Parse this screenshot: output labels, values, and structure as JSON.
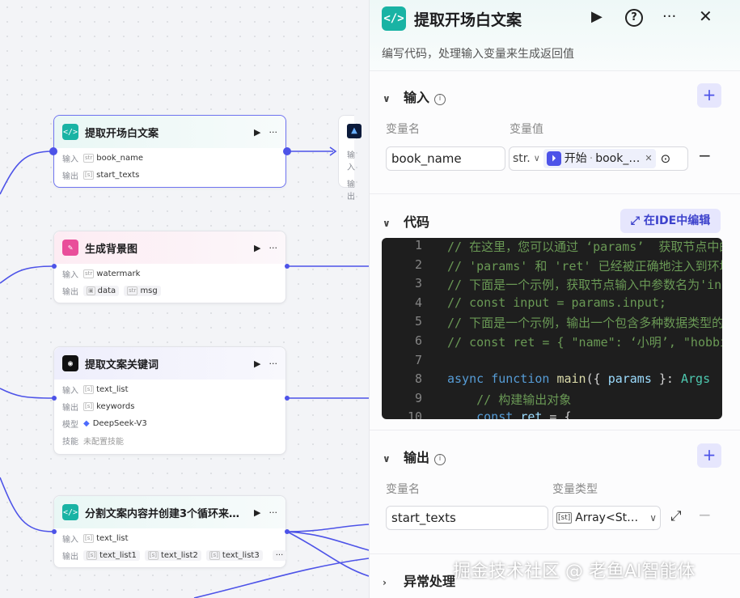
{
  "canvas": {
    "nodes": [
      {
        "title": "提取开场白文案",
        "icon": "code-icon",
        "color": "#19b3a4",
        "rows": [
          {
            "label": "输入",
            "tags": [
              {
                "type": "str",
                "name": "book_name"
              }
            ]
          },
          {
            "label": "输出",
            "tags": [
              {
                "type": "[str]",
                "name": "start_texts"
              }
            ]
          }
        ]
      },
      {
        "title": "生成背景图",
        "icon": "image-gen-icon",
        "color": "#e94e9a",
        "rows": [
          {
            "label": "输入",
            "tags": [
              {
                "type": "str",
                "name": "watermark"
              }
            ]
          },
          {
            "label": "输出",
            "tags": [
              {
                "type": "img",
                "name": "data"
              },
              {
                "type": "str",
                "name": "msg"
              }
            ]
          }
        ]
      },
      {
        "title": "提取文案关键词",
        "icon": "llm-icon",
        "color": "#111111",
        "rows": [
          {
            "label": "输入",
            "tags": [
              {
                "type": "[str]",
                "name": "text_list"
              }
            ]
          },
          {
            "label": "输出",
            "tags": [
              {
                "type": "[str]",
                "name": "keywords"
              }
            ]
          },
          {
            "label": "模型",
            "tags": [
              {
                "type": "model",
                "name": "DeepSeek-V3"
              }
            ]
          },
          {
            "label": "技能",
            "tags": [
              {
                "type": "none",
                "name": "未配置技能"
              }
            ]
          }
        ]
      },
      {
        "title": "分割文案内容并创建3个循环来…",
        "icon": "code-icon",
        "color": "#19b3a4",
        "rows": [
          {
            "label": "输入",
            "tags": [
              {
                "type": "[str]",
                "name": "text_list"
              }
            ]
          },
          {
            "label": "输出",
            "tags": [
              {
                "type": "[str]",
                "name": "text_list1"
              },
              {
                "type": "[str]",
                "name": "text_list2"
              },
              {
                "type": "[str]",
                "name": "text_list3"
              },
              {
                "type": "more",
                "name": "···"
              }
            ]
          }
        ]
      }
    ],
    "stub_labels": [
      "输入",
      "输出"
    ]
  },
  "panel": {
    "title": "提取开场白文案",
    "description": "编写代码，处理输入变量来生成返回值",
    "input": {
      "title": "输入",
      "col_name": "变量名",
      "col_value": "变量值",
      "var_name": "book_name",
      "type_select": "str.",
      "ref_source": "开始",
      "ref_var": "book_…"
    },
    "code": {
      "title": "代码",
      "ide_button": "在IDE中编辑",
      "lines": [
        {
          "n": "1",
          "parts": [
            {
              "c": "cmt",
              "t": "// 在这里，您可以通过 ‘params’  获取节点中的输入变量"
            }
          ]
        },
        {
          "n": "2",
          "parts": [
            {
              "c": "cmt",
              "t": "// 'params' 和 'ret' 已经被正确地注入到环境中"
            }
          ]
        },
        {
          "n": "3",
          "parts": [
            {
              "c": "cmt",
              "t": "// 下面是一个示例，获取节点输入中参数名为'input'的值"
            }
          ]
        },
        {
          "n": "4",
          "parts": [
            {
              "c": "cmt",
              "t": "// const input = params.input;"
            }
          ]
        },
        {
          "n": "5",
          "parts": [
            {
              "c": "cmt",
              "t": "// 下面是一个示例，输出一个包含多种数据类型的 'ret' 对象"
            }
          ]
        },
        {
          "n": "6",
          "parts": [
            {
              "c": "cmt",
              "t": "// const ret = { \"name\": ‘小明’, \"hobbies\""
            }
          ]
        },
        {
          "n": "7",
          "parts": [
            {
              "c": "pl",
              "t": ""
            }
          ]
        },
        {
          "n": "8",
          "parts": [
            {
              "c": "kw",
              "t": "async"
            },
            {
              "c": "pl",
              "t": " "
            },
            {
              "c": "kw",
              "t": "function"
            },
            {
              "c": "pl",
              "t": " "
            },
            {
              "c": "fn",
              "t": "main"
            },
            {
              "c": "pl",
              "t": "({ "
            },
            {
              "c": "var",
              "t": "params"
            },
            {
              "c": "pl",
              "t": " }: "
            },
            {
              "c": "ty",
              "t": "Args"
            }
          ]
        },
        {
          "n": "9",
          "parts": [
            {
              "c": "cmt",
              "t": "    // 构建输出对象"
            }
          ]
        },
        {
          "n": "10",
          "parts": [
            {
              "c": "kw",
              "t": "    const"
            },
            {
              "c": "pl",
              "t": " "
            },
            {
              "c": "var",
              "t": "ret"
            },
            {
              "c": "pl",
              "t": " = {"
            }
          ]
        }
      ]
    },
    "output": {
      "title": "输出",
      "col_name": "变量名",
      "col_type": "变量类型",
      "var_name": "start_texts",
      "type_value": "Array<St…"
    },
    "error": {
      "title": "异常处理"
    }
  },
  "watermark": "掘金技术社区 @ 老鱼AI智能体",
  "colors": {
    "accent": "#4d53e8",
    "code_bg": "#1e1e1e",
    "code_icon": "#19b3a4"
  }
}
